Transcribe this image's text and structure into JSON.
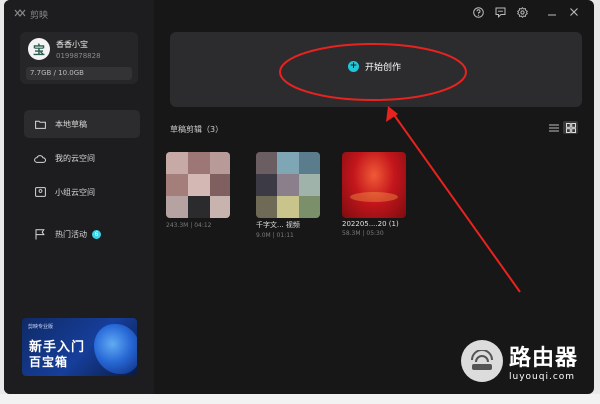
{
  "app": {
    "name": "剪映"
  },
  "user": {
    "avatar_char": "宝",
    "name": "香香小宝",
    "id": "0199878828",
    "storage": "7.7GB / 10.0GB"
  },
  "sidebar": {
    "items": [
      {
        "label": "本地草稿",
        "icon": "folder-icon"
      },
      {
        "label": "我的云空间",
        "icon": "cloud-icon"
      },
      {
        "label": "小组云空间",
        "icon": "group-icon"
      },
      {
        "label": "热门活动",
        "icon": "flag-icon",
        "badge": "6"
      }
    ]
  },
  "banner": {
    "small_text": "剪映专业版",
    "line1": "新手入门",
    "line2": "百宝箱"
  },
  "main": {
    "create_label": "开始创作",
    "drafts_title": "草稿剪辑（3）",
    "drafts": [
      {
        "title": "",
        "meta": "243.3M | 04:12"
      },
      {
        "title": "千字文... 视频",
        "meta": "9.0M | 01:11"
      },
      {
        "title": "202205....20 (1)",
        "meta": "58.3M | 05:30"
      }
    ]
  },
  "watermark": {
    "cn": "路由器",
    "url": "luyouqi.com"
  },
  "colors": {
    "accent": "#23c6d8",
    "annotation": "#e8231f"
  }
}
